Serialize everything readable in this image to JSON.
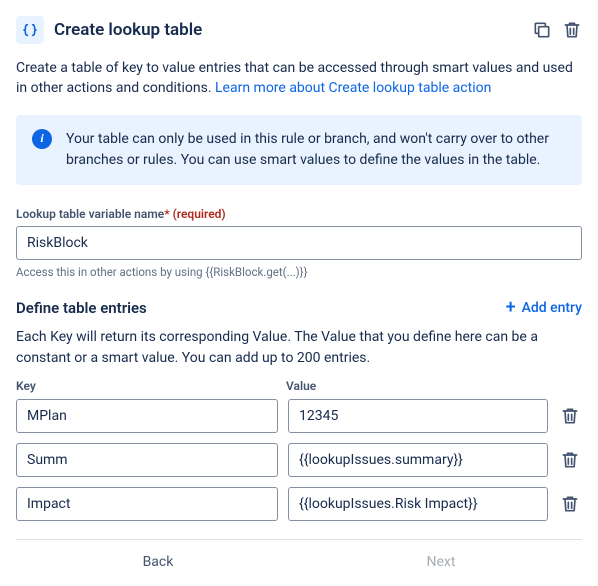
{
  "header": {
    "title": "Create lookup table"
  },
  "description": {
    "text": "Create a table of key to value entries that can be accessed through smart values and used in other actions and conditions. ",
    "link": "Learn more about Create lookup table action"
  },
  "info": {
    "text": "Your table can only be used in this rule or branch, and won't carry over to other branches or rules. You can use smart values to define the values in the table."
  },
  "variable": {
    "label": "Lookup table variable name",
    "required": " (required)",
    "value": "RiskBlock",
    "helper": "Access this in other actions by using {{RiskBlock.get(...)}}"
  },
  "define": {
    "heading": "Define table entries",
    "add": "Add entry",
    "description": "Each Key will return its corresponding Value. The Value that you define here can be a constant or a smart value. You can add up to 200 entries.",
    "key_col": "Key",
    "value_col": "Value",
    "entries": [
      {
        "key": "MPlan",
        "value": "12345"
      },
      {
        "key": "Summ",
        "value": "{{lookupIssues.summary}}"
      },
      {
        "key": "Impact",
        "value": "{{lookupIssues.Risk Impact}}"
      }
    ]
  },
  "footer": {
    "back": "Back",
    "next": "Next"
  }
}
